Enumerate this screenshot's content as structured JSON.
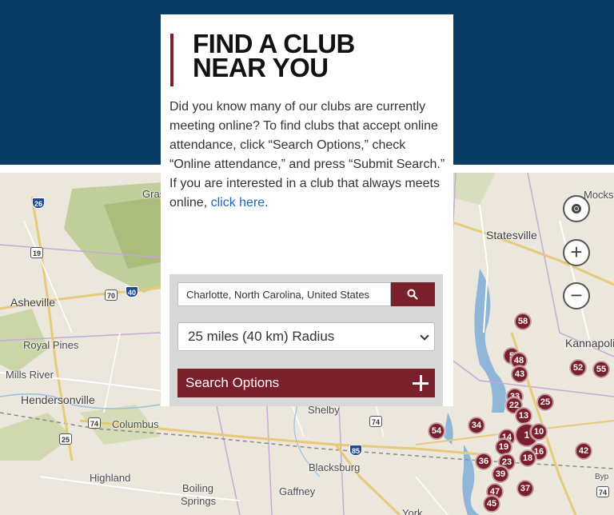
{
  "header": {
    "title_line1": "FIND A CLUB",
    "title_line2": "NEAR YOU"
  },
  "intro": {
    "paragraph1": "Did you know many of our clubs are currently meeting online? To find clubs that accept online attendance, click “Search Options,” check “Online attendance,” and press “Submit Search.”",
    "paragraph2_prefix": "If you are interested in a club that always meets online, ",
    "link_text": "click here",
    "paragraph2_suffix": "."
  },
  "search": {
    "location_value": "Charlotte, North Carolina, United States",
    "radius_selected": "25 miles (40 km) Radius",
    "options_label": "Search Options",
    "button_icon": "search-icon"
  },
  "colors": {
    "navy": "#0a3d66",
    "maroon": "#7a1f2c",
    "link": "#1a65c0"
  },
  "map": {
    "places": [
      "Asheville",
      "Royal Pines",
      "Mills River",
      "Hendersonville",
      "Columbus",
      "Highland",
      "Boiling",
      "Springs",
      "Gaffney",
      "Blacksburg",
      "Shelby",
      "Statesville",
      "Kannapolis",
      "Mocksville",
      "Gras",
      "York",
      "Byp"
    ],
    "shields": [
      "26",
      "19",
      "70",
      "40",
      "74",
      "25",
      "74",
      "85",
      "74"
    ],
    "markers": [
      "58",
      "5",
      "48",
      "43",
      "52",
      "55",
      "33",
      "22",
      "25",
      "13",
      "34",
      "54",
      "14",
      "1",
      "10",
      "19",
      "16",
      "23",
      "18",
      "42",
      "36",
      "39",
      "37",
      "47",
      "45"
    ],
    "controls": [
      "locate-icon",
      "zoom-in-icon",
      "zoom-out-icon"
    ]
  }
}
